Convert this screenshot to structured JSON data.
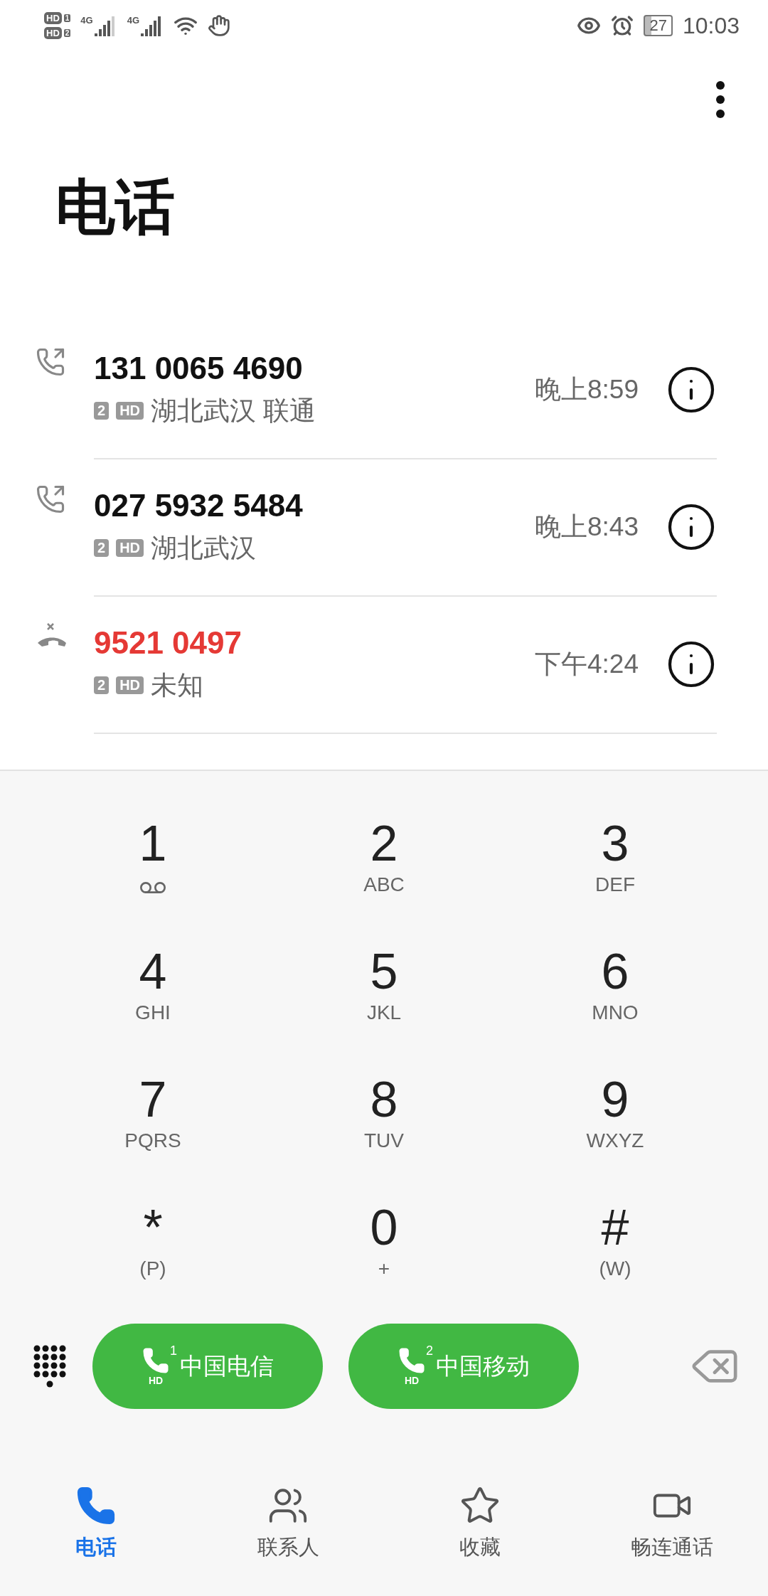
{
  "status_bar": {
    "sims": [
      {
        "badge": "HD",
        "slot": "1"
      },
      {
        "badge": "HD",
        "slot": "2"
      }
    ],
    "networks": [
      "4G",
      "4G"
    ],
    "battery": "27",
    "time": "10:03"
  },
  "title": "电话",
  "calls": [
    {
      "kind": "outgoing",
      "number": "131 0065 4690",
      "sim": "2",
      "hd": "HD",
      "location": "湖北武汉 联通",
      "time": "晚上8:59"
    },
    {
      "kind": "outgoing",
      "number": "027 5932 5484",
      "sim": "2",
      "hd": "HD",
      "location": "湖北武汉",
      "time": "晚上8:43"
    },
    {
      "kind": "missed",
      "number": "9521 0497",
      "sim": "2",
      "hd": "HD",
      "location": "未知",
      "time": "下午4:24"
    }
  ],
  "keys": [
    {
      "digit": "1",
      "kind": "voicemail"
    },
    {
      "digit": "2",
      "letters": "ABC"
    },
    {
      "digit": "3",
      "letters": "DEF"
    },
    {
      "digit": "4",
      "letters": "GHI"
    },
    {
      "digit": "5",
      "letters": "JKL"
    },
    {
      "digit": "6",
      "letters": "MNO"
    },
    {
      "digit": "7",
      "letters": "PQRS"
    },
    {
      "digit": "8",
      "letters": "TUV"
    },
    {
      "digit": "9",
      "letters": "WXYZ"
    },
    {
      "digit": "*",
      "letters": "(P)"
    },
    {
      "digit": "0",
      "letters": "+"
    },
    {
      "digit": "#",
      "letters": "(W)"
    }
  ],
  "call_buttons": [
    {
      "sim": "1",
      "hd": "HD",
      "carrier": "中国电信"
    },
    {
      "sim": "2",
      "hd": "HD",
      "carrier": "中国移动"
    }
  ],
  "tabs": [
    {
      "kind": "phone",
      "label": "电话",
      "selected": true
    },
    {
      "kind": "contacts",
      "label": "联系人",
      "selected": false
    },
    {
      "kind": "favorites",
      "label": "收藏",
      "selected": false
    },
    {
      "kind": "video",
      "label": "畅连通话",
      "selected": false
    }
  ]
}
